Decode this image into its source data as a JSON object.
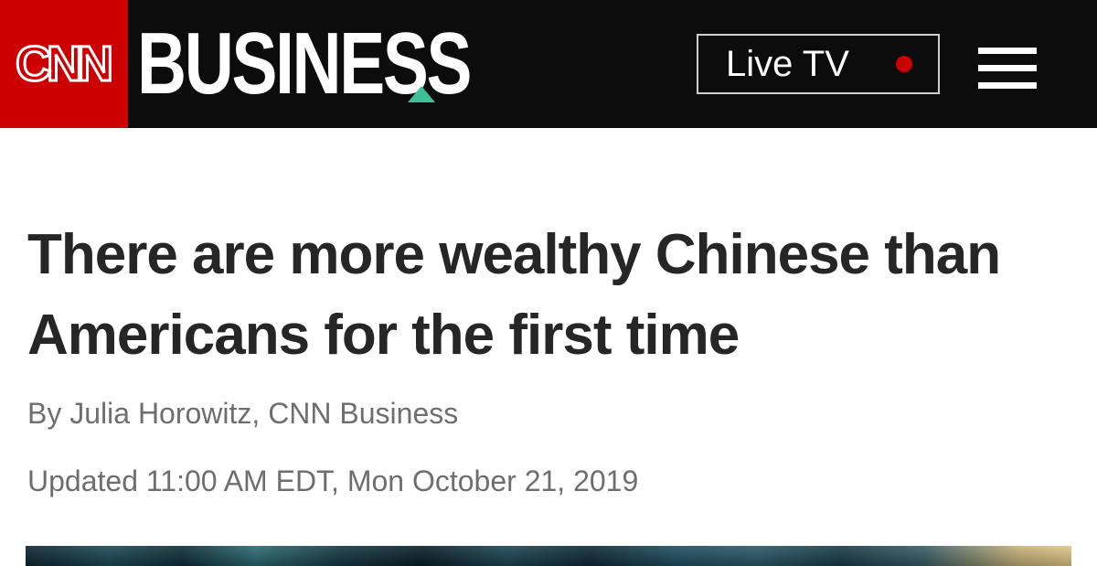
{
  "header": {
    "logo_text": "CNN",
    "section": "BUSINESS",
    "live_tv_label": "Live TV",
    "menu_icon": "hamburger-menu-icon",
    "accent_color": "#3fbf95",
    "live_dot_color": "#cc0000",
    "brand_color": "#cc0000"
  },
  "article": {
    "headline": "There are more wealthy Chinese than Americans for the first time",
    "byline": "By Julia Horowitz, CNN Business",
    "updated": "Updated 11:00 AM EDT, Mon October 21, 2019"
  }
}
